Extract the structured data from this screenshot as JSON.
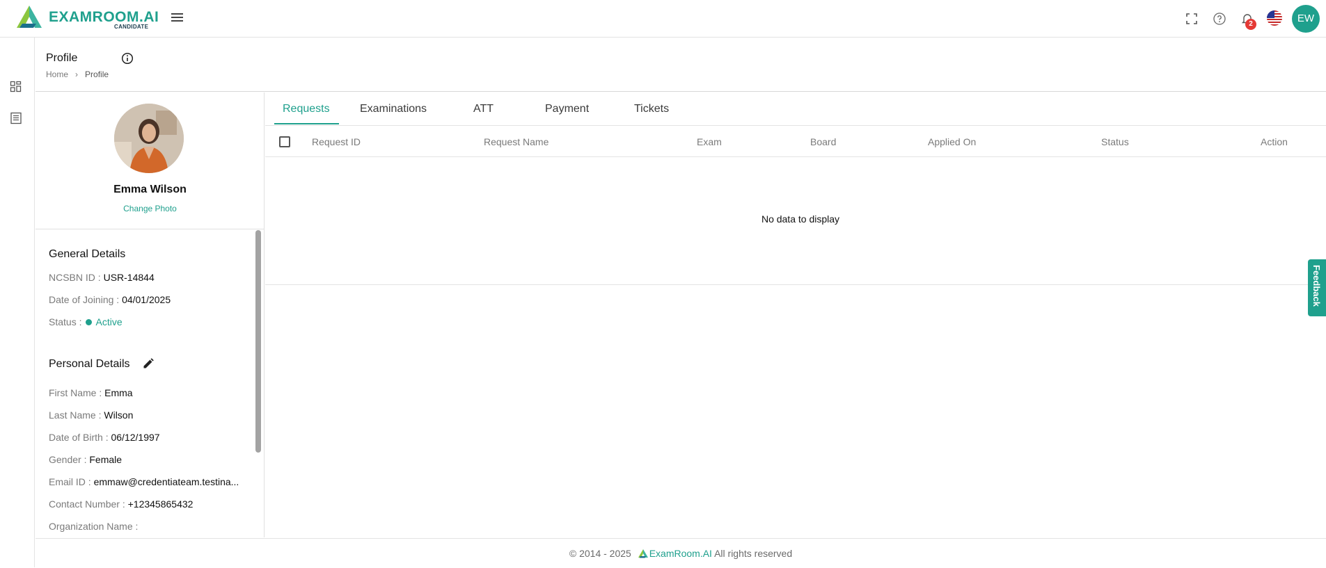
{
  "header": {
    "logo_text": "EXAMROOM.AI",
    "logo_sub": "CANDIDATE",
    "notification_count": "2",
    "user_initials": "EW"
  },
  "page": {
    "title": "Profile",
    "breadcrumb": [
      "Home",
      "Profile"
    ]
  },
  "profile": {
    "name": "Emma Wilson",
    "change_photo": "Change Photo",
    "general_title": "General Details",
    "general": [
      {
        "label": "NCSBN ID : ",
        "value": "USR-14844"
      },
      {
        "label": "Date of Joining : ",
        "value": "04/01/2025"
      },
      {
        "label": "Status : ",
        "value": "Active"
      }
    ],
    "personal_title": "Personal Details",
    "personal": [
      {
        "label": "First Name : ",
        "value": "Emma"
      },
      {
        "label": "Last Name : ",
        "value": "Wilson"
      },
      {
        "label": "Date of Birth : ",
        "value": "06/12/1997"
      },
      {
        "label": "Gender : ",
        "value": "Female"
      },
      {
        "label": "Email ID : ",
        "value": "emmaw@credentiateam.testina..."
      },
      {
        "label": "Contact Number : ",
        "value": "+12345865432"
      },
      {
        "label": "Organization Name : ",
        "value": ""
      }
    ]
  },
  "tabs": [
    "Requests",
    "Examinations",
    "ATT",
    "Payment",
    "Tickets"
  ],
  "table": {
    "columns": [
      "Request ID",
      "Request Name",
      "Exam",
      "Board",
      "Applied On",
      "Status",
      "Action"
    ],
    "empty_text": "No data to display"
  },
  "footer": {
    "copyright": "© 2014 - 2025",
    "brand": "ExamRoom.AI",
    "rights": "All rights reserved"
  },
  "feedback_label": "Feedback",
  "colors": {
    "accent": "#1fa08d",
    "badge": "#e53935"
  }
}
